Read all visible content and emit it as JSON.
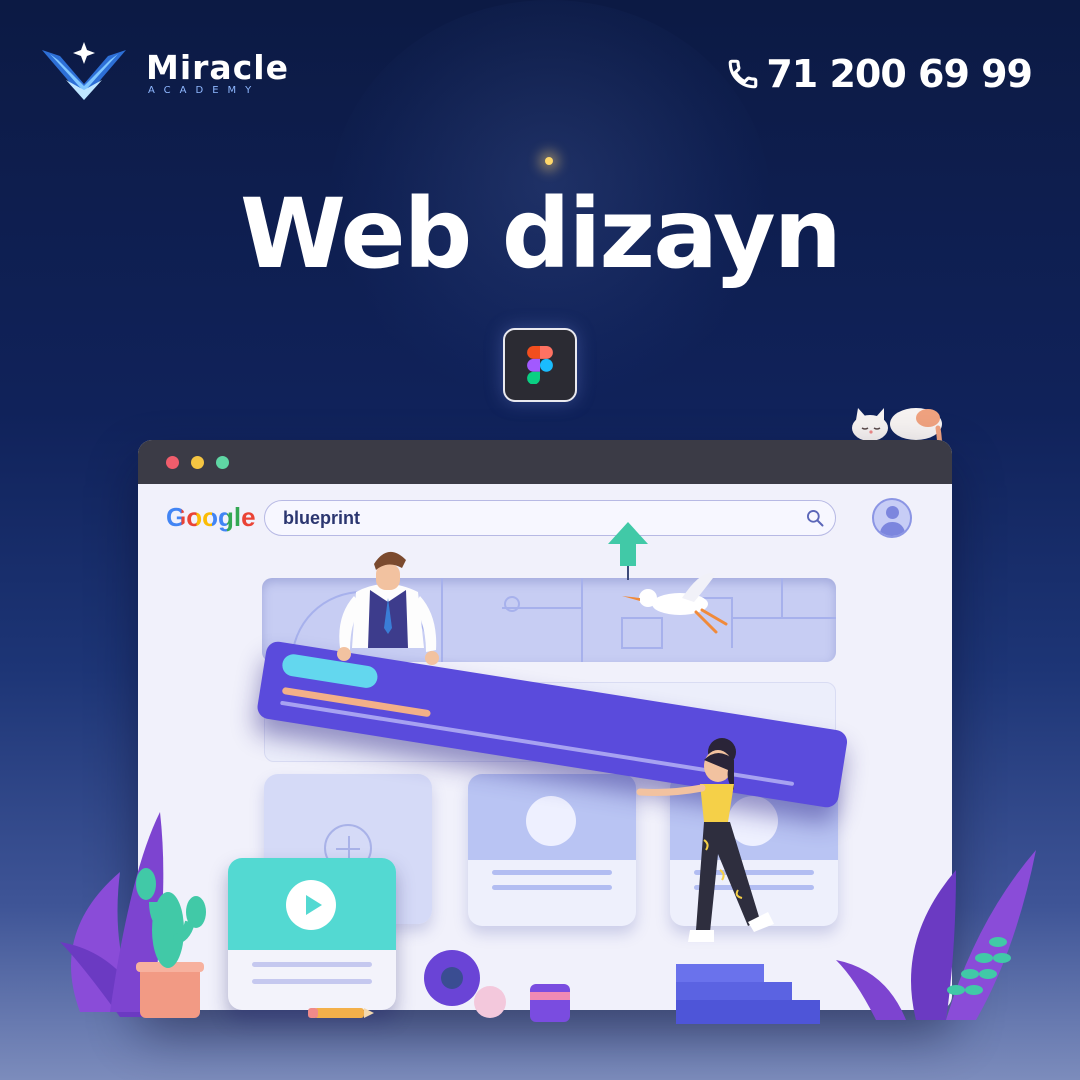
{
  "brand": {
    "name": "Miracle",
    "tagline": "ACADEMY"
  },
  "contact": {
    "phone": "71 200 69 99"
  },
  "headline": "Web dizayn",
  "browser": {
    "search_engine": "Google",
    "search_query": "blueprint"
  },
  "colors": {
    "background_top": "#0c1a44",
    "background_bottom": "#7c8cbc",
    "accent_purple": "#5a4bdc",
    "accent_teal": "#53d9d2"
  }
}
